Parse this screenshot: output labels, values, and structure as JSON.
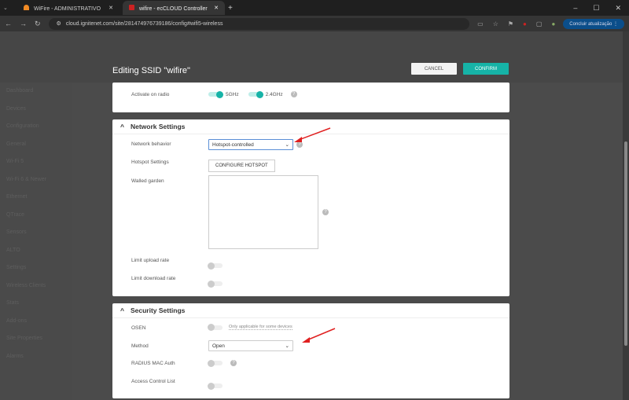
{
  "browser": {
    "tabs": [
      {
        "label": "WiFire - ADMINISTRATIVO"
      },
      {
        "label": "wifire - ecCLOUD Controller"
      }
    ],
    "url": "cloud.ignitenet.com/site/28147497673​9186/config#wifi5-wireless",
    "update_label": "Concluir atualização"
  },
  "sidebar": {
    "items": [
      "Dashboard",
      "Devices",
      "Configuration",
      "General",
      "Wi-Fi 5",
      "Wi-Fi 6 & Newer",
      "Ethernet",
      "QTrace",
      "Sensors",
      "ALTO",
      "Settings",
      "Wireless Clients",
      "Stats",
      "Add-ons",
      "Site Properties",
      "Alarms"
    ]
  },
  "modal": {
    "title": "Editing SSID \"wifire\"",
    "cancel": "CANCEL",
    "confirm": "CONFIRM"
  },
  "radio": {
    "label": "Activate on radio",
    "options": [
      {
        "label": "5GHz",
        "on": true
      },
      {
        "label": "2.4GHz",
        "on": true
      }
    ]
  },
  "network": {
    "title": "Network Settings",
    "behavior_label": "Network behavior",
    "behavior_value": "Hotspot-controlled",
    "hotspot_label": "Hotspot Settings",
    "hotspot_button": "CONFIGURE HOTSPOT",
    "walled_label": "Walled garden",
    "walled_value": "",
    "upload_label": "Limit upload rate",
    "download_label": "Limit download rate"
  },
  "security": {
    "title": "Security Settings",
    "osen_label": "OSEN",
    "osen_note": "Only applicable for some devices",
    "method_label": "Method",
    "method_value": "Open",
    "radius_label": "RADIUS MAC Auth",
    "acl_label": "Access Control List"
  },
  "colors": {
    "accent": "#17b3a7",
    "arrow": "#e02020"
  }
}
